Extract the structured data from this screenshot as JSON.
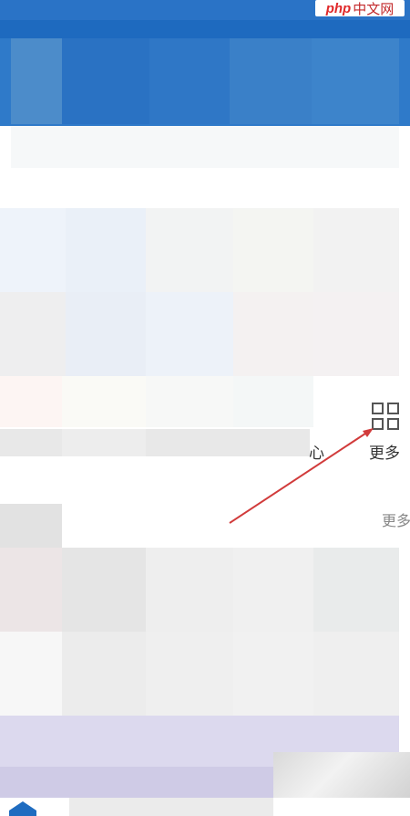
{
  "watermark": {
    "text_latin": "php",
    "text_cjk": "中文网"
  },
  "shortcuts": {
    "partial_label": "心",
    "more_label": "更多",
    "more_icon": "grid-icon"
  },
  "section": {
    "more_link": "更多"
  },
  "colors": {
    "brand_blue": "#1e6abf",
    "arrow_red": "#d13b3b"
  }
}
